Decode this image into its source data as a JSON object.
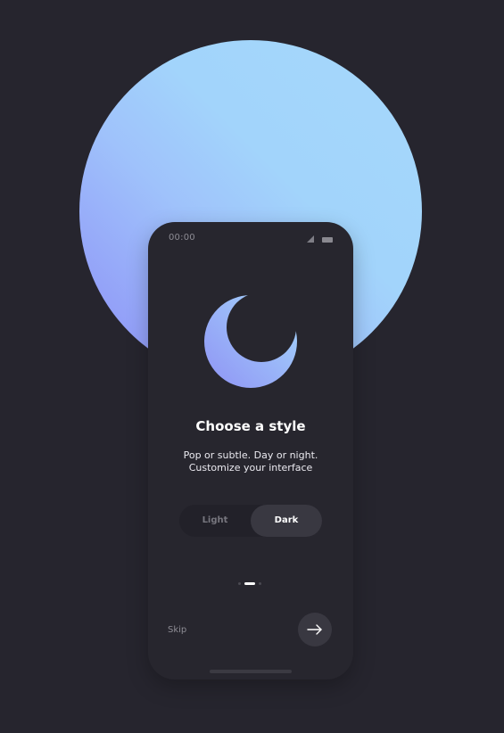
{
  "status_bar": {
    "time": "00:00",
    "signal_icon": "signal-icon",
    "battery_icon": "battery-icon"
  },
  "illustration": {
    "icon": "crescent-moon-icon",
    "gradient_colors": [
      "#a5d8fb",
      "#8f93f5"
    ]
  },
  "onboarding": {
    "title": "Choose a style",
    "subtitle_lines": [
      "Pop or subtle. Day or night.",
      "Customize your interface"
    ]
  },
  "theme_toggle": {
    "options": [
      {
        "label": "Light",
        "selected": false
      },
      {
        "label": "Dark",
        "selected": true
      }
    ]
  },
  "pagination": {
    "current_page": 2,
    "total_pages": 3
  },
  "footer": {
    "skip_label": "Skip",
    "next_icon": "arrow-right-icon"
  },
  "colors": {
    "background": "#26252e",
    "phone": "#27262e",
    "accent_light": "#a5d8fb",
    "accent_dark": "#8f93f5",
    "selected_pill": "#393841"
  }
}
